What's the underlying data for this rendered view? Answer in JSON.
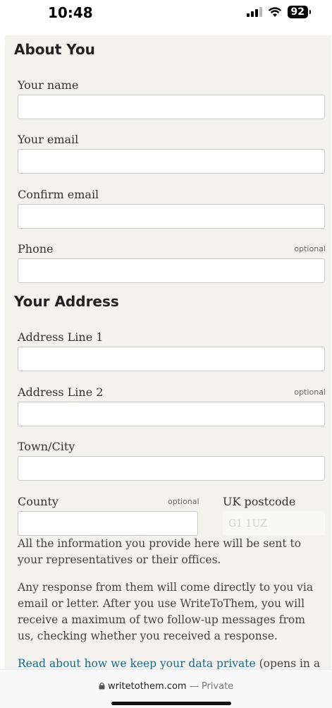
{
  "status_bar": {
    "time": "10:48",
    "battery": "92",
    "icons": [
      "signal-icon",
      "wifi-icon",
      "battery-icon"
    ]
  },
  "about": {
    "title": "About You",
    "name_label": "Your name",
    "name_value": "",
    "email_label": "Your email",
    "email_value": "",
    "confirm_label": "Confirm email",
    "confirm_value": "",
    "phone_label": "Phone",
    "phone_optional": "optional",
    "phone_value": ""
  },
  "address": {
    "title": "Your Address",
    "line1_label": "Address Line 1",
    "line1_value": "",
    "line2_label": "Address Line 2",
    "line2_optional": "optional",
    "line2_value": "",
    "town_label": "Town/City",
    "town_value": "",
    "county_label": "County",
    "county_optional": "optional",
    "county_value": "",
    "postcode_label": "UK postcode",
    "postcode_placeholder": "G1 1UZ",
    "postcode_value": ""
  },
  "info": {
    "para1": "All the information you provide here will be sent to your representatives or their offices.",
    "para2": "Any response from them will come directly to you via email or letter. After you use WriteToThem, you will receive a maximum of two follow-up messages from us, checking whether you received a response.",
    "privacy_link": "Read about how we keep your data private",
    "privacy_suffix": " (opens in a"
  },
  "browser": {
    "domain": "writetothem.com",
    "mode": " — Private"
  },
  "colors": {
    "panel_bg": "#f3f2ef",
    "link": "#1a6b8a"
  }
}
